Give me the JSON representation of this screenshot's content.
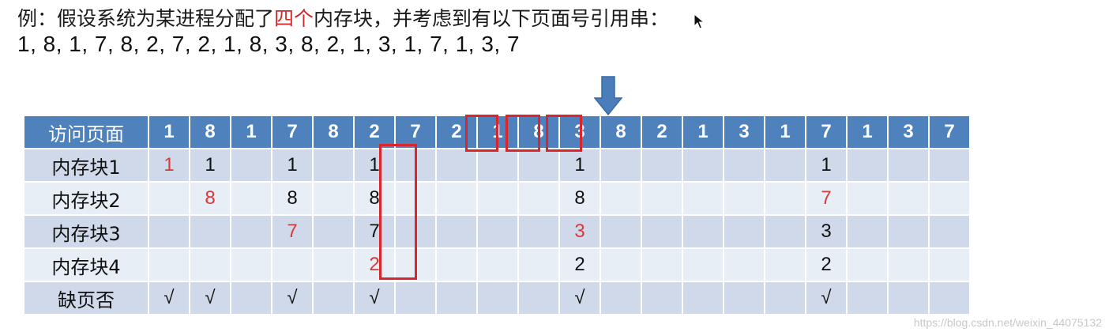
{
  "intro": {
    "before": "例：假设系统为某进程分配了",
    "highlight": "四个",
    "after": "内存块，并考虑到有以下页面号引用串："
  },
  "reference_string": "1, 8, 1, 7, 8, 2, 7, 2, 1, 8, 3, 8, 2, 1, 3, 1, 7, 1, 3, 7",
  "table": {
    "header_label": "访问页面",
    "pages": [
      "1",
      "8",
      "1",
      "7",
      "8",
      "2",
      "7",
      "2",
      "1",
      "8",
      "3",
      "8",
      "2",
      "1",
      "3",
      "1",
      "7",
      "1",
      "3",
      "7"
    ],
    "rows": [
      {
        "label": "内存块1",
        "cells": [
          "1",
          "1",
          "",
          "1",
          "",
          "1",
          "",
          "",
          "",
          "",
          "1",
          "",
          "",
          "",
          "",
          "",
          "1",
          "",
          "",
          ""
        ],
        "red": [
          0
        ]
      },
      {
        "label": "内存块2",
        "cells": [
          "",
          "8",
          "",
          "8",
          "",
          "8",
          "",
          "",
          "",
          "",
          "8",
          "",
          "",
          "",
          "",
          "",
          "7",
          "",
          "",
          ""
        ],
        "red": [
          1,
          16
        ]
      },
      {
        "label": "内存块3",
        "cells": [
          "",
          "",
          "",
          "7",
          "",
          "7",
          "",
          "",
          "",
          "",
          "3",
          "",
          "",
          "",
          "",
          "",
          "3",
          "",
          "",
          ""
        ],
        "red": [
          3,
          10
        ]
      },
      {
        "label": "内存块4",
        "cells": [
          "",
          "",
          "",
          "",
          "",
          "2",
          "",
          "",
          "",
          "",
          "2",
          "",
          "",
          "",
          "",
          "",
          "2",
          "",
          "",
          ""
        ],
        "red": [
          5
        ]
      },
      {
        "label": "缺页否",
        "cells": [
          "√",
          "√",
          "",
          "√",
          "",
          "√",
          "",
          "",
          "",
          "",
          "√",
          "",
          "",
          "",
          "",
          "",
          "√",
          "",
          "",
          ""
        ],
        "red": []
      }
    ]
  },
  "colors": {
    "header_blue": "#4f81bd",
    "accent_red": "#d9262c",
    "arrow_blue": "#4a7ebb"
  },
  "icons": {
    "arrow": "down-arrow-icon",
    "cursor": "mouse-cursor-icon"
  },
  "watermark": "https://blog.csdn.net/weixin_44075132"
}
